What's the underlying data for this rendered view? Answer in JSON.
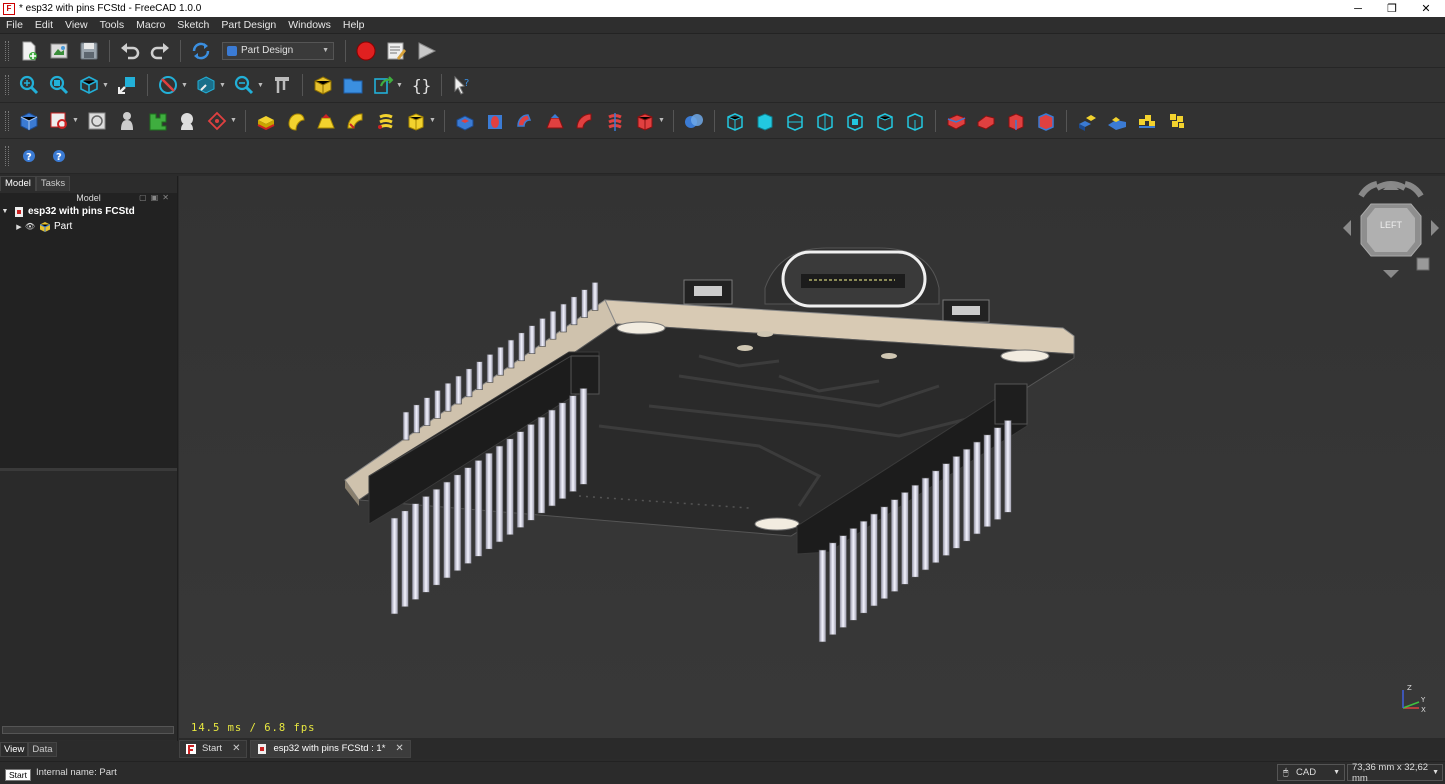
{
  "window": {
    "title": "* esp32 with pins FCStd - FreeCAD 1.0.0",
    "app_icon": "freecad-logo"
  },
  "menu": [
    "File",
    "Edit",
    "View",
    "Tools",
    "Macro",
    "Sketch",
    "Part Design",
    "Windows",
    "Help"
  ],
  "workbench": {
    "selected": "Part Design"
  },
  "panel": {
    "tabs": [
      "Model",
      "Tasks"
    ],
    "header": "Model",
    "tree": [
      {
        "label": "esp32 with pins FCStd",
        "expanded": true
      },
      {
        "label": "Part",
        "expanded": false
      }
    ],
    "bottom_tabs": [
      "View",
      "Data"
    ]
  },
  "navcube": {
    "face": "LEFT"
  },
  "viewport": {
    "fps": "14.5 ms / 6.8 fps"
  },
  "doc_tabs": [
    {
      "label": "Start"
    },
    {
      "label": "esp32 with pins FCStd : 1*"
    }
  ],
  "status": {
    "start_label": "Start",
    "message": "Internal name: Part",
    "nav_style": "CAD",
    "dimensions": "73,36 mm x 32,62 mm"
  },
  "colors": {
    "accent": "#3b7bd4",
    "record": "#e02020",
    "fps": "#e8e840",
    "pcb": "#2a2a2a",
    "board_edge": "#cfc2ad"
  }
}
